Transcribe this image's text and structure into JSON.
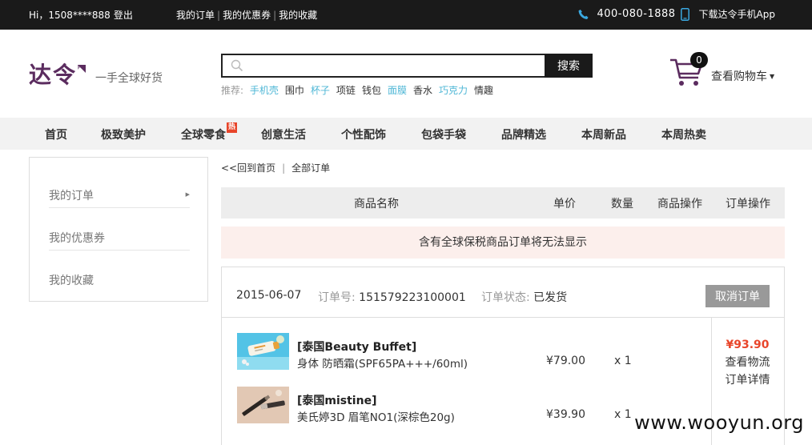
{
  "topbar": {
    "greeting": "Hi，1508****888",
    "logout": "登出",
    "links": [
      "我的订单",
      "我的优惠券",
      "我的收藏"
    ],
    "hotline": "400-080-1888",
    "app_download": "下载达令手机App"
  },
  "header": {
    "logo": "达令",
    "slogan": "一手全球好货",
    "search": {
      "placeholder": "",
      "button": "搜索",
      "hot_label": "推荐:",
      "hot_terms": [
        {
          "text": "手机壳",
          "highlight": true
        },
        {
          "text": "围巾",
          "highlight": false
        },
        {
          "text": "杯子",
          "highlight": true
        },
        {
          "text": "项链",
          "highlight": false
        },
        {
          "text": "钱包",
          "highlight": false
        },
        {
          "text": "面膜",
          "highlight": true
        },
        {
          "text": "香水",
          "highlight": false
        },
        {
          "text": "巧克力",
          "highlight": true
        },
        {
          "text": "情趣",
          "highlight": false
        }
      ]
    },
    "cart": {
      "count": "0",
      "label": "查看购物车"
    }
  },
  "nav": {
    "items": [
      "首页",
      "极致美护",
      "全球零食",
      "创意生活",
      "个性配饰",
      "包袋手袋",
      "品牌精选",
      "本周新品",
      "本周热卖"
    ],
    "hot_badge": "热"
  },
  "sidebar": {
    "items": [
      "我的订单",
      "我的优惠券",
      "我的收藏"
    ]
  },
  "breadcrumb": {
    "back": "<<回到首页",
    "current": "全部订单"
  },
  "table": {
    "headers": [
      "商品名称",
      "单价",
      "数量",
      "商品操作",
      "订单操作"
    ]
  },
  "notice": "含有全球保税商品订单将无法显示",
  "order": {
    "date": "2015-06-07",
    "number_label": "订单号:",
    "number": "151579223100001",
    "status_label": "订单状态:",
    "status": "已发货",
    "cancel": "取消订单",
    "total": "¥93.90",
    "track": "查看物流",
    "detail": "订单详情",
    "items": [
      {
        "name": "[泰国Beauty Buffet]",
        "desc": "身体 防晒霜(SPF65PA+++/60ml)",
        "price": "¥79.00",
        "qty": "x 1"
      },
      {
        "name": "[泰国mistine]",
        "desc": "美氏婷3D 眉笔NO1(深棕色20g)",
        "price": "¥39.90",
        "qty": "x 1"
      }
    ]
  },
  "watermark": "www.wooyun.org",
  "colors": {
    "accent_red": "#e8452a",
    "highlight_blue": "#4fb7d6",
    "brand_purple": "#5b2c5f"
  }
}
